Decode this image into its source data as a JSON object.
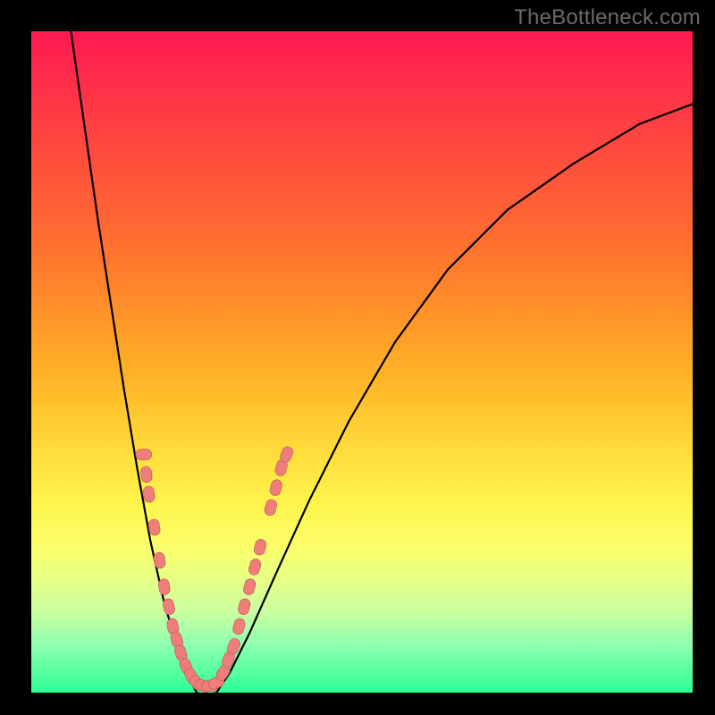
{
  "watermark": "TheBottleneck.com",
  "colors": {
    "frame": "#000000",
    "curve": "#000000",
    "dot_fill": "#ef7d79",
    "dot_stroke": "#b65a55",
    "gradient_top": "#ff1a52",
    "gradient_bottom": "#2cff94"
  },
  "chart_data": {
    "type": "line",
    "title": "",
    "xlabel": "",
    "ylabel": "",
    "xlim": [
      0,
      100
    ],
    "ylim": [
      0,
      100
    ],
    "grid": false,
    "legend": false,
    "series": [
      {
        "name": "left-branch",
        "x": [
          6,
          8,
          10,
          12,
          14,
          16,
          18,
          20,
          22,
          24,
          25
        ],
        "y": [
          100,
          86,
          72,
          59,
          46,
          34,
          23,
          14,
          7,
          2,
          0
        ]
      },
      {
        "name": "right-branch",
        "x": [
          28,
          30,
          33,
          37,
          42,
          48,
          55,
          63,
          72,
          82,
          92,
          100
        ],
        "y": [
          0,
          3,
          9,
          18,
          29,
          41,
          53,
          64,
          73,
          80,
          86,
          89
        ]
      }
    ],
    "annotations": [
      {
        "name": "dot",
        "x": 17.0,
        "y": 36
      },
      {
        "name": "dot",
        "x": 17.4,
        "y": 33
      },
      {
        "name": "dot",
        "x": 17.8,
        "y": 30
      },
      {
        "name": "dot",
        "x": 18.6,
        "y": 25
      },
      {
        "name": "dot",
        "x": 19.4,
        "y": 20
      },
      {
        "name": "dot",
        "x": 20.1,
        "y": 16
      },
      {
        "name": "dot",
        "x": 20.8,
        "y": 13
      },
      {
        "name": "dot",
        "x": 21.4,
        "y": 10
      },
      {
        "name": "dot",
        "x": 22.0,
        "y": 8
      },
      {
        "name": "dot",
        "x": 22.6,
        "y": 6
      },
      {
        "name": "dot",
        "x": 23.4,
        "y": 4
      },
      {
        "name": "dot",
        "x": 24.2,
        "y": 2.5
      },
      {
        "name": "dot",
        "x": 25.0,
        "y": 1.5
      },
      {
        "name": "dot",
        "x": 26.0,
        "y": 1
      },
      {
        "name": "dot",
        "x": 27.0,
        "y": 1
      },
      {
        "name": "dot",
        "x": 28.0,
        "y": 1.5
      },
      {
        "name": "dot",
        "x": 29.0,
        "y": 3
      },
      {
        "name": "dot",
        "x": 29.8,
        "y": 5
      },
      {
        "name": "dot",
        "x": 30.6,
        "y": 7
      },
      {
        "name": "dot",
        "x": 31.4,
        "y": 10
      },
      {
        "name": "dot",
        "x": 32.2,
        "y": 13
      },
      {
        "name": "dot",
        "x": 33.0,
        "y": 16
      },
      {
        "name": "dot",
        "x": 33.8,
        "y": 19
      },
      {
        "name": "dot",
        "x": 34.6,
        "y": 22
      },
      {
        "name": "dot",
        "x": 36.2,
        "y": 28
      },
      {
        "name": "dot",
        "x": 37.0,
        "y": 31
      },
      {
        "name": "dot",
        "x": 37.8,
        "y": 34
      },
      {
        "name": "dot",
        "x": 38.6,
        "y": 36
      }
    ]
  }
}
